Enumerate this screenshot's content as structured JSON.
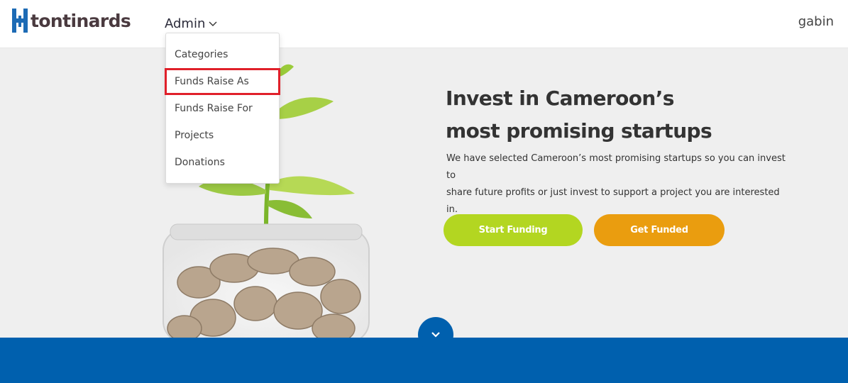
{
  "header": {
    "brand": "tontinards",
    "admin_label": "Admin",
    "user_name": "gabin"
  },
  "admin_dropdown": {
    "items": [
      {
        "label": "Categories"
      },
      {
        "label": "Funds Raise As"
      },
      {
        "label": "Funds Raise For"
      },
      {
        "label": "Projects"
      },
      {
        "label": "Donations"
      }
    ]
  },
  "hero": {
    "title_line1": "Invest in Cameroon’s",
    "title_line2": "most promising startups",
    "subtitle_line1": "We have selected Cameroon’s most promising startups so you can invest to",
    "subtitle_line2": "share future profits or just invest to support a project you are interested in.",
    "start_funding_label": "Start Funding",
    "get_funded_label": "Get Funded"
  },
  "colors": {
    "brand_blue": "#0060ae",
    "start_green": "#b3d621",
    "get_orange": "#ea9d0f",
    "highlight_red": "#e0202a"
  },
  "icons": {
    "logo": "tontinards-logo-icon",
    "admin_chevron": "chevron-down-icon",
    "scroll": "chevron-down-icon"
  }
}
